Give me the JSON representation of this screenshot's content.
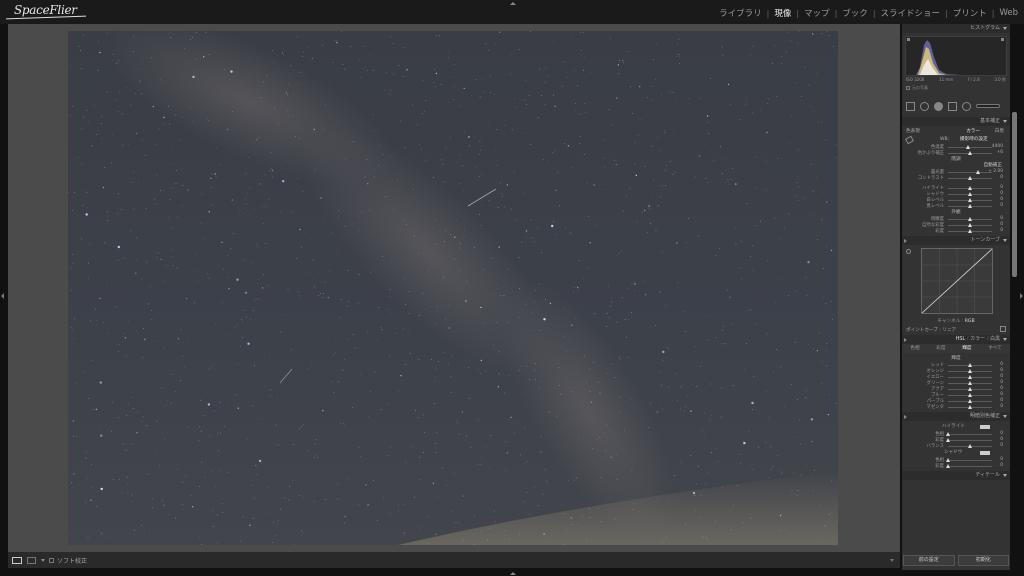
{
  "app": {
    "brand": "SpaceFlier",
    "modules": [
      "ライブラリ",
      "現像",
      "マップ",
      "ブック",
      "スライドショー",
      "プリント",
      "Web"
    ],
    "active_module": "現像"
  },
  "panel": {
    "histogram": {
      "title": "ヒストグラム",
      "iso": "ISO 3200",
      "focal": "11 mm",
      "aperture": "f / 2.8",
      "shutter": "3.0 秒",
      "original_photo": "元の写真"
    },
    "basic": {
      "title": "基本補正",
      "treatment_label": "色表現",
      "treatment_color": "カラー",
      "treatment_bw": "白黒",
      "wb_label": "WB:",
      "wb_value": "撮影時の設定",
      "wb_rows": [
        {
          "label": "色温度",
          "value": "4400",
          "pos": 0.45
        },
        {
          "label": "色かぶり補正",
          "value": "+6",
          "pos": 0.5
        }
      ],
      "tone_label": "階調",
      "auto_label": "自動補正",
      "exposure_rows": [
        {
          "label": "露光量",
          "value": "+ 2.00",
          "pos": 0.68
        },
        {
          "label": "コントラスト",
          "value": "0",
          "pos": 0.5
        }
      ],
      "tone_rows": [
        {
          "label": "ハイライト",
          "value": "0",
          "pos": 0.5
        },
        {
          "label": "シャドウ",
          "value": "0",
          "pos": 0.5
        },
        {
          "label": "白レベル",
          "value": "0",
          "pos": 0.5
        },
        {
          "label": "黒レベル",
          "value": "0",
          "pos": 0.5
        }
      ],
      "presence_label": "外観",
      "presence_rows": [
        {
          "label": "明瞭度",
          "value": "0",
          "pos": 0.5
        },
        {
          "label": "自然な彩度",
          "value": "0",
          "pos": 0.5
        },
        {
          "label": "彩度",
          "value": "0",
          "pos": 0.5
        }
      ]
    },
    "tone_curve": {
      "title": "トーンカーブ",
      "channel_label": "チャンネル :",
      "channel_value": "RGB",
      "point_curve_label": "ポイントカーブ :",
      "point_curve_value": "リニア"
    },
    "hsl": {
      "header": [
        "HSL",
        "カラー",
        "白黒"
      ],
      "tabs": [
        "色相",
        "彩度",
        "輝度",
        "すべて"
      ],
      "active_tab": "輝度",
      "subhead": "輝度",
      "rows": [
        {
          "label": "レッド",
          "value": "0",
          "pos": 0.5
        },
        {
          "label": "オレンジ",
          "value": "0",
          "pos": 0.5
        },
        {
          "label": "イエロー",
          "value": "0",
          "pos": 0.5
        },
        {
          "label": "グリーン",
          "value": "0",
          "pos": 0.5
        },
        {
          "label": "アクア",
          "value": "0",
          "pos": 0.5
        },
        {
          "label": "ブルー",
          "value": "0",
          "pos": 0.5
        },
        {
          "label": "パープル",
          "value": "0",
          "pos": 0.5
        },
        {
          "label": "マゼンタ",
          "value": "0",
          "pos": 0.5
        }
      ]
    },
    "split_toning": {
      "title": "明暗別色補正",
      "highlights_label": "ハイライト",
      "highlights_rows": [
        {
          "label": "色相",
          "value": "0",
          "pos": 0.0
        },
        {
          "label": "彩度",
          "value": "0",
          "pos": 0.0
        }
      ],
      "balance_label": "バランス",
      "balance": {
        "label": "バランス",
        "value": "0",
        "pos": 0.5
      },
      "shadows_label": "シャドウ",
      "shadows_rows": [
        {
          "label": "色相",
          "value": "0",
          "pos": 0.0
        },
        {
          "label": "彩度",
          "value": "0",
          "pos": 0.0
        }
      ]
    },
    "detail": {
      "title": "ディテール"
    },
    "buttons": {
      "previous": "前の設定",
      "reset": "初期化"
    }
  },
  "toolbar": {
    "soft_proof": "ソフト校正"
  },
  "colors": {
    "accent": "#eeeeee",
    "panel": "#333333",
    "canvas": "#4b4b4b",
    "sky": "#3b4049"
  }
}
